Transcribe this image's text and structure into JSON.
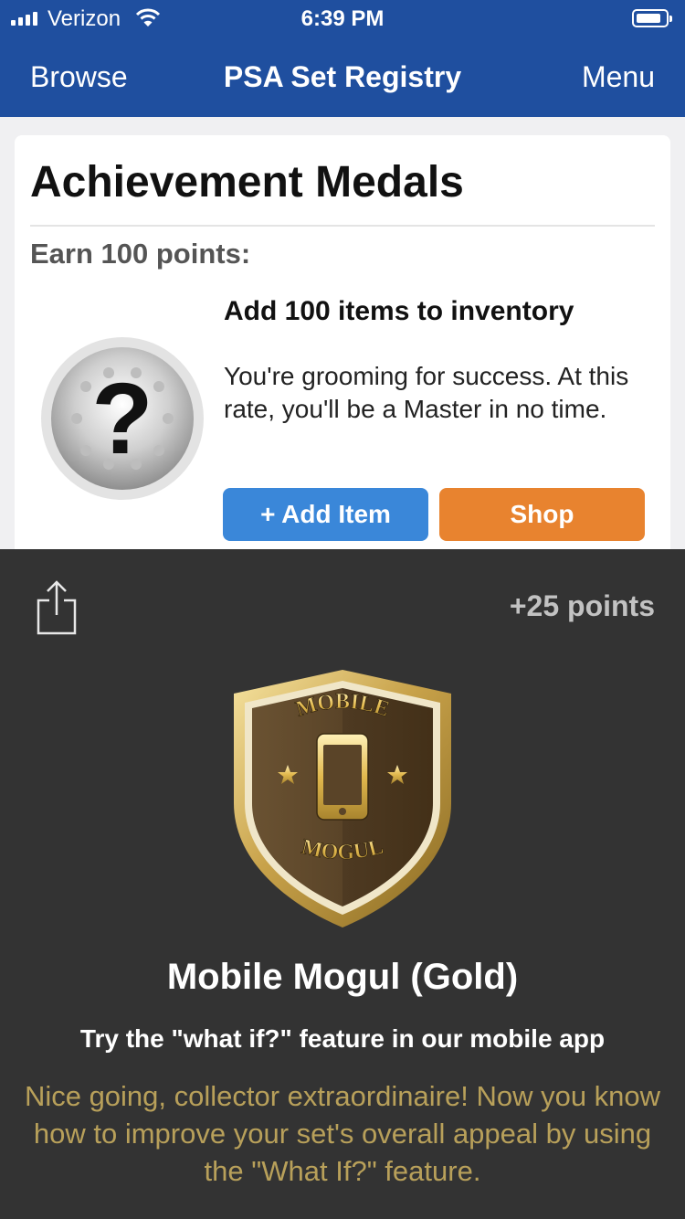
{
  "status_bar": {
    "carrier": "Verizon",
    "time": "6:39 PM"
  },
  "nav": {
    "left": "Browse",
    "title": "PSA Set Registry",
    "right": "Menu"
  },
  "card": {
    "title": "Achievement Medals",
    "earn_label": "Earn 100 points:",
    "item_title": "Add 100 items to inventory",
    "item_desc": "You're grooming for success. At this rate, you'll be a Master in no time.",
    "add_button": "+ Add Item",
    "shop_button": "Shop"
  },
  "modal": {
    "points": "+25 points",
    "badge_top_text": "MOBILE",
    "badge_bottom_text": "MOGUL",
    "medal_name": "Mobile Mogul (Gold)",
    "medal_task": "Try the \"what if?\" feature in our mobile app",
    "medal_message": "Nice going, collector extraordinaire! Now you know how to improve your set's overall appeal by using the \"What If?\" feature."
  },
  "colors": {
    "nav_bg": "#1f4f9f",
    "add_button": "#3a87d9",
    "shop_button": "#e8832f",
    "modal_bg": "#333333",
    "gold_text": "#b8a05a"
  },
  "icons": [
    "signal-icon",
    "wifi-icon",
    "battery-icon",
    "mystery-medal-icon",
    "share-icon",
    "mobile-mogul-badge-icon"
  ]
}
